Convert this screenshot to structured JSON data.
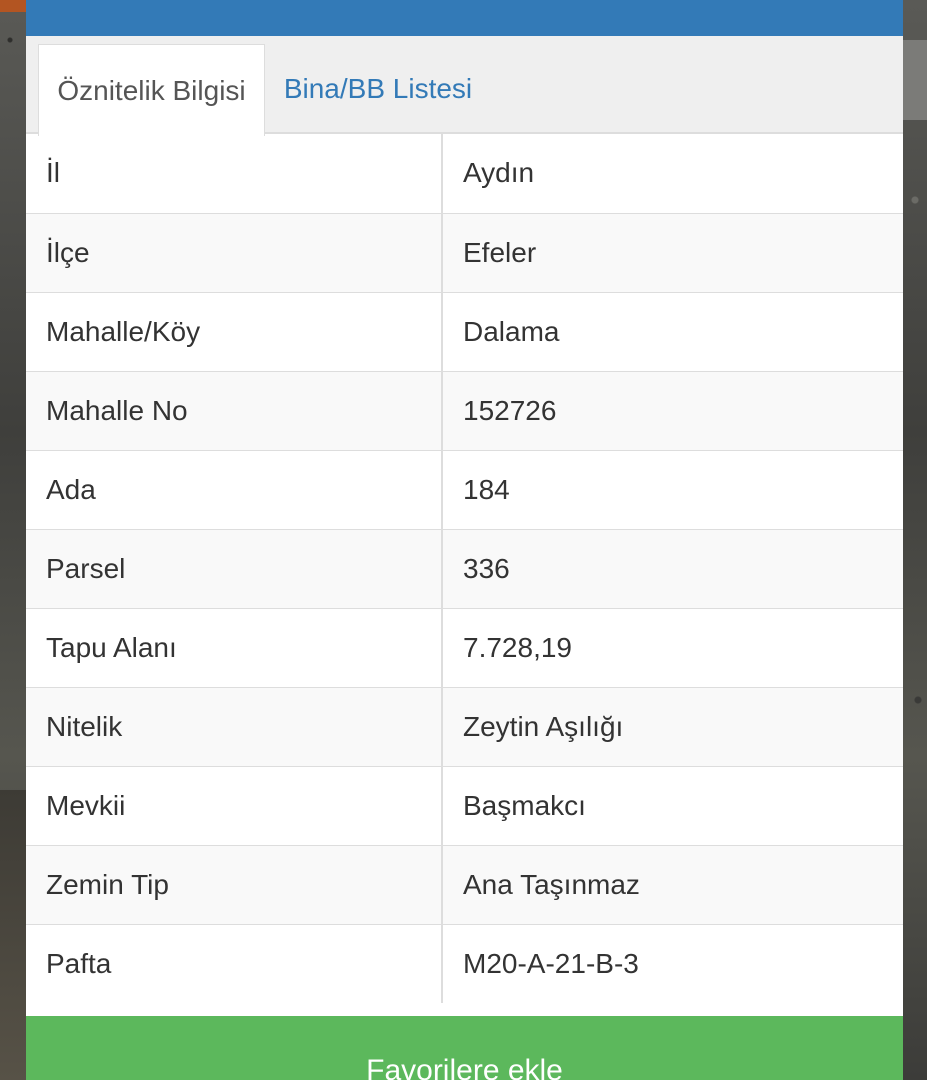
{
  "tabs": {
    "active": "Öznitelik Bilgisi",
    "second": "Bina/BB Listesi"
  },
  "rows": [
    {
      "key": "İl",
      "value": "Aydın"
    },
    {
      "key": "İlçe",
      "value": "Efeler"
    },
    {
      "key": "Mahalle/Köy",
      "value": "Dalama"
    },
    {
      "key": "Mahalle No",
      "value": "152726"
    },
    {
      "key": "Ada",
      "value": "184"
    },
    {
      "key": "Parsel",
      "value": "336"
    },
    {
      "key": "Tapu Alanı",
      "value": "7.728,19"
    },
    {
      "key": "Nitelik",
      "value": "Zeytin Aşılığı"
    },
    {
      "key": "Mevkii",
      "value": "Başmakcı"
    },
    {
      "key": "Zemin Tip",
      "value": "Ana Taşınmaz"
    },
    {
      "key": "Pafta",
      "value": "M20-A-21-B-3"
    }
  ],
  "actions": {
    "favorite_label": "Favorilere ekle"
  },
  "colors": {
    "header_blue": "#337ab7",
    "button_green": "#5cb85c"
  }
}
